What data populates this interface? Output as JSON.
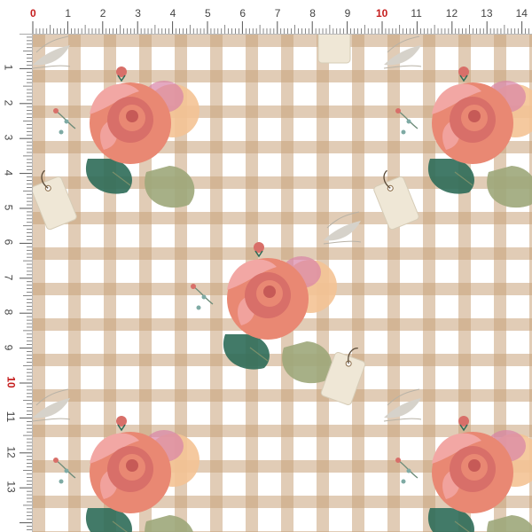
{
  "ruler": {
    "top_labels": [
      "0",
      "1",
      "2",
      "3",
      "4",
      "5",
      "6",
      "7",
      "8",
      "9",
      "10",
      "11",
      "12",
      "13",
      "14"
    ],
    "left_labels": [
      "1",
      "2",
      "3",
      "4",
      "5",
      "6",
      "7",
      "8",
      "9",
      "10",
      "11",
      "12",
      "13"
    ],
    "highlight_color": "#c51d1d"
  },
  "pattern": {
    "background": "#ffffff",
    "gingham_color": "#c8a27a",
    "rose_colors": [
      "#e98873",
      "#f2a7a4",
      "#f4c395",
      "#d86f69"
    ],
    "leaf_colors": [
      "#2d6b58",
      "#9da77a"
    ],
    "tag_color": "#efe7d6"
  }
}
